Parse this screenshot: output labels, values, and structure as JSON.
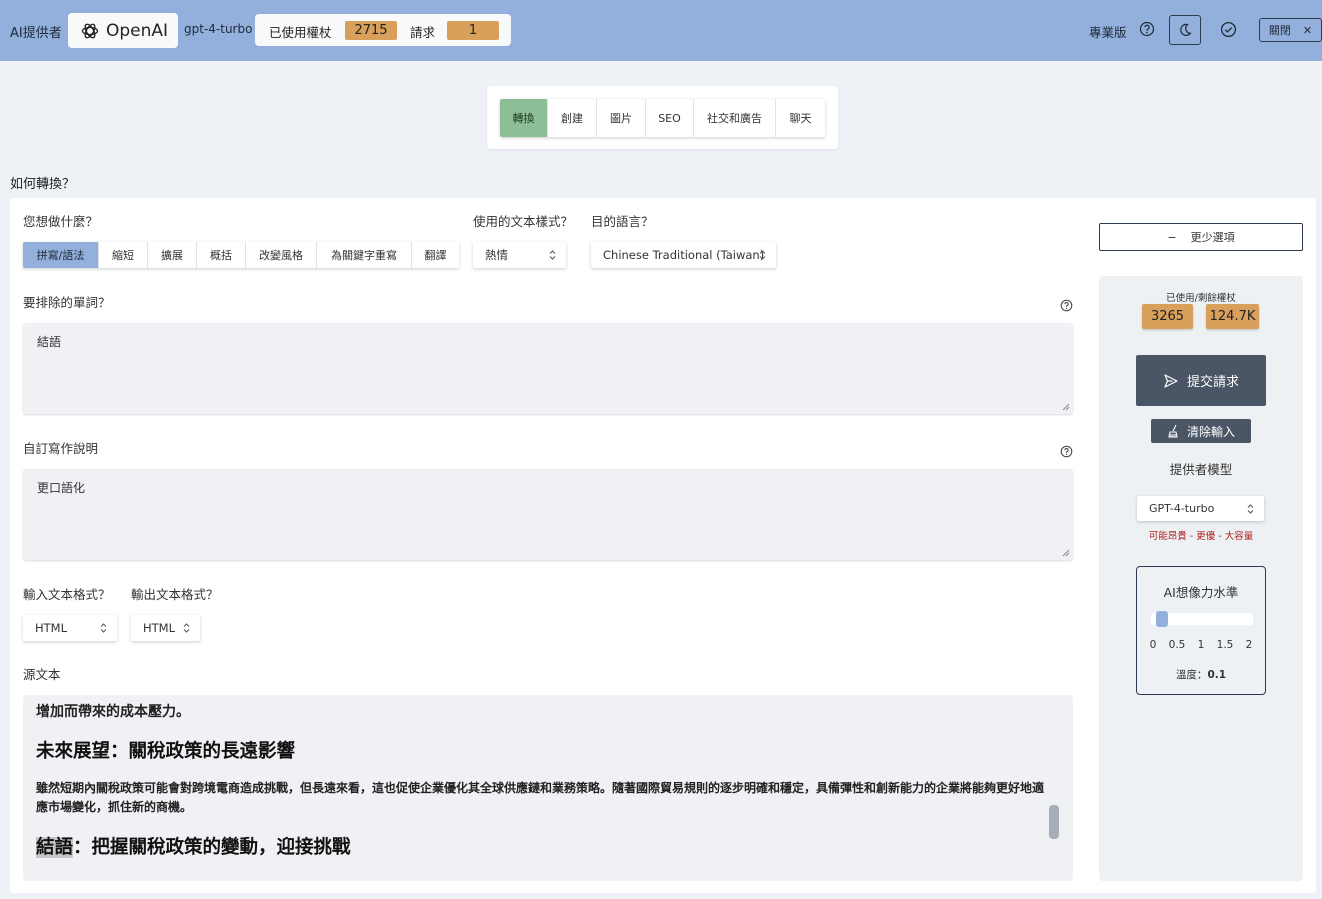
{
  "header": {
    "provider_label": "AI提供者",
    "provider_name": "OpenAI",
    "model": "gpt-4-turbo",
    "used_tokens_label": "已使用權杖",
    "used_tokens": "2715",
    "requests_label": "請求",
    "requests": "1",
    "plan": "專業版",
    "close_label": "關閉"
  },
  "tabs": [
    {
      "label": "轉換",
      "active": true
    },
    {
      "label": "創建"
    },
    {
      "label": "圖片"
    },
    {
      "label": "SEO"
    },
    {
      "label": "社交和廣告"
    },
    {
      "label": "聊天"
    }
  ],
  "section_title": "如何轉換？",
  "form": {
    "action_label": "您想做什麼？",
    "actions": [
      "拼寫/語法",
      "縮短",
      "擴展",
      "概括",
      "改變風格",
      "為關鍵字重寫",
      "翻譯"
    ],
    "style_label": "使用的文本樣式？",
    "style_value": "熱情",
    "lang_label": "目的語言？",
    "lang_value": "Chinese Traditional (Taiwan)",
    "exclude_label": "要排除的單詞？",
    "exclude_value": "結語",
    "custom_label": "自訂寫作說明",
    "custom_value": "更口語化",
    "input_format_label": "輸入文本格式？",
    "input_format_value": "HTML",
    "output_format_label": "輸出文本格式？",
    "output_format_value": "HTML",
    "source_label": "源文本",
    "source": {
      "cut_line": "增加而帶來的成本壓力。",
      "heading1": "未來展望：關稅政策的長遠影響",
      "paragraph": "雖然短期內關稅政策可能會對跨境電商造成挑戰，但長遠來看，這也促使企業優化其全球供應鏈和業務策略。隨著國際貿易規則的逐步明確和穩定，具備彈性和創新能力的企業將能夠更好地適應市場變化，抓住新的商機。",
      "heading2_highlight": "結語",
      "heading2_rest": "：把握關稅政策的變動，迎接挑戰"
    }
  },
  "side": {
    "less_options": "更少選項",
    "tokens_caption": "已使用/剩餘權杖",
    "used": "3265",
    "remaining": "124.7K",
    "submit": "提交請求",
    "clear": "清除輸入",
    "model_caption": "提供者模型",
    "model_value": "GPT-4-turbo",
    "model_note": "可能昂貴 - 更優 - 大容量",
    "imagination_title": "AI想像力水準",
    "slider_ticks": [
      "0",
      "0.5",
      "1",
      "1.5",
      "2"
    ],
    "slider_value": 0.1,
    "temperature_label": "溫度：",
    "temperature_value": "0.1"
  }
}
